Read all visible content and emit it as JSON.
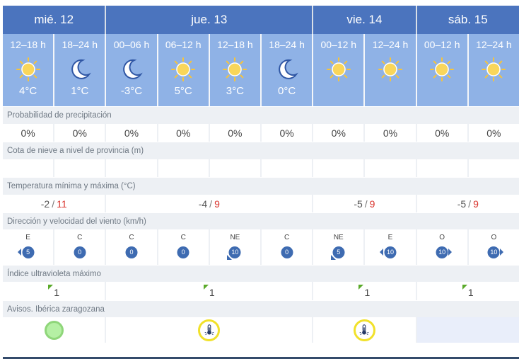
{
  "days": [
    {
      "label": "mié. 12",
      "span": 2
    },
    {
      "label": "jue. 13",
      "span": 4
    },
    {
      "label": "vie. 14",
      "span": 2
    },
    {
      "label": "sáb. 15",
      "span": 2
    }
  ],
  "periods": [
    {
      "label": "12–18 h",
      "icon": "sun-icon",
      "temp": "4°C"
    },
    {
      "label": "18–24 h",
      "icon": "moon-icon",
      "temp": "1°C"
    },
    {
      "label": "00–06 h",
      "icon": "moon-icon",
      "temp": "-3°C"
    },
    {
      "label": "06–12 h",
      "icon": "sun-icon",
      "temp": "5°C"
    },
    {
      "label": "12–18 h",
      "icon": "sun-icon",
      "temp": "3°C"
    },
    {
      "label": "18–24 h",
      "icon": "moon-icon",
      "temp": "0°C"
    },
    {
      "label": "00–12 h",
      "icon": "sun-icon",
      "temp": ""
    },
    {
      "label": "12–24 h",
      "icon": "sun-icon",
      "temp": ""
    },
    {
      "label": "00–12 h",
      "icon": "sun-icon",
      "temp": ""
    },
    {
      "label": "12–24 h",
      "icon": "sun-icon",
      "temp": ""
    }
  ],
  "sections": {
    "precip": "Probabilidad de precipitación",
    "snow": "Cota de nieve a nivel de provincia (m)",
    "temp": "Temperatura mínima y máxima (°C)",
    "wind": "Dirección y velocidad del viento (km/h)",
    "uv": "Índice ultravioleta máximo",
    "avisos": "Avisos. Ibérica zaragozana"
  },
  "precip": [
    "0%",
    "0%",
    "0%",
    "0%",
    "0%",
    "0%",
    "0%",
    "0%",
    "0%",
    "0%"
  ],
  "snow": [
    "",
    "",
    "",
    "",
    "",
    "",
    "",
    "",
    "",
    ""
  ],
  "temp_range": [
    {
      "min": "-2",
      "sep": "/",
      "max": "11",
      "span": 2
    },
    {
      "min": "-4",
      "sep": "/",
      "max": "9",
      "span": 4
    },
    {
      "min": "-5",
      "sep": "/",
      "max": "9",
      "span": 2
    },
    {
      "min": "-5",
      "sep": "/",
      "max": "9",
      "span": 2
    }
  ],
  "wind": [
    {
      "dir": "E",
      "speed": "5",
      "arrow": "left"
    },
    {
      "dir": "C",
      "speed": "0",
      "arrow": "none"
    },
    {
      "dir": "C",
      "speed": "0",
      "arrow": "none"
    },
    {
      "dir": "C",
      "speed": "0",
      "arrow": "none"
    },
    {
      "dir": "NE",
      "speed": "10",
      "arrow": "sw"
    },
    {
      "dir": "C",
      "speed": "0",
      "arrow": "none"
    },
    {
      "dir": "NE",
      "speed": "5",
      "arrow": "sw"
    },
    {
      "dir": "E",
      "speed": "10",
      "arrow": "left"
    },
    {
      "dir": "O",
      "speed": "10",
      "arrow": "right"
    },
    {
      "dir": "O",
      "speed": "10",
      "arrow": "right"
    }
  ],
  "uv": [
    {
      "value": "1",
      "span": 2
    },
    {
      "value": "1",
      "span": 4
    },
    {
      "value": "1",
      "span": 2
    },
    {
      "value": "1",
      "span": 2
    }
  ],
  "avisos": [
    {
      "level": "green",
      "span": 2
    },
    {
      "level": "yellow-temperature",
      "span": 4
    },
    {
      "level": "yellow-temperature",
      "span": 2
    },
    {
      "level": "none",
      "span": 2
    }
  ],
  "colors": {
    "header": "#4b74be",
    "period": "#8fb2e6",
    "tmax": "#d9352e",
    "badge": "#3e6bb1",
    "uv_flag": "#5aaa2a",
    "aviso_green": "#8fd67a",
    "aviso_yellow": "#f1e12a"
  }
}
